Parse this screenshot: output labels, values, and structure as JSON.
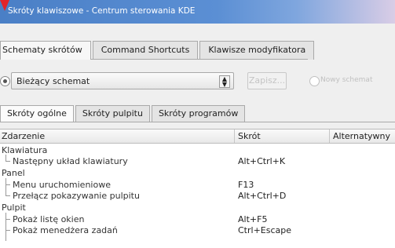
{
  "window": {
    "title": "Skróty klawiszowe - Centrum sterowania KDE"
  },
  "tabs_top": [
    {
      "label": "Schematy skrótów",
      "active": true
    },
    {
      "label": "Command Shortcuts",
      "active": false
    },
    {
      "label": "Klawisze modyfikatora",
      "active": false
    }
  ],
  "scheme": {
    "current_label": "Bieżący schemat",
    "save_label": "Zapisz...",
    "new_scheme_label": "Nowy schemat"
  },
  "tabs_sub": [
    {
      "label": "Skróty ogólne",
      "active": true
    },
    {
      "label": "Skróty pulpitu",
      "active": false
    },
    {
      "label": "Skróty programów",
      "active": false
    }
  ],
  "table": {
    "columns": [
      "Zdarzenie",
      "Skrót",
      "Alternatywny"
    ],
    "rows": [
      {
        "type": "group",
        "name": "Klawiatura",
        "shortcut": ""
      },
      {
        "type": "leaf",
        "name": "Następny układ klawiatury",
        "shortcut": "Alt+Ctrl+K"
      },
      {
        "type": "group",
        "name": "Panel",
        "shortcut": ""
      },
      {
        "type": "leaf",
        "name": "Menu uruchomieniowe",
        "shortcut": "F13"
      },
      {
        "type": "leaf",
        "name": "Przełącz pokazywanie pulpitu",
        "shortcut": "Alt+Ctrl+D"
      },
      {
        "type": "group",
        "name": "Pulpit",
        "shortcut": ""
      },
      {
        "type": "leaf",
        "name": "Pokaż listę okien",
        "shortcut": "Alt+F5"
      },
      {
        "type": "leaf",
        "name": "Pokaż menedżera zadań",
        "shortcut": "Ctrl+Escape"
      }
    ]
  },
  "colors": {
    "titlebar": "#4a7fc6",
    "accent_arrow": "#e2232a"
  },
  "icons": {
    "corner": "red-arrow-icon",
    "combo_arrow": "chevron-updown-icon"
  }
}
